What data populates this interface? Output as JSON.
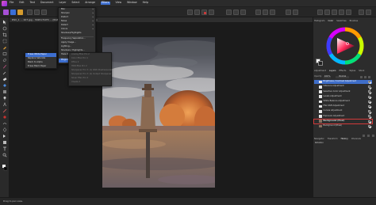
{
  "menubar": {
    "items": [
      "File",
      "Edit",
      "Text",
      "Document",
      "Layer",
      "Select",
      "Arrange",
      "Filters",
      "View",
      "Window",
      "Help"
    ]
  },
  "document": {
    "tab_label": "DSC_1 ... 207.jpg - 3420×5470 ... (RGBA/8) - sRGB IEC61966-2.1 (JPEG)",
    "close": "×"
  },
  "filters_menu": {
    "items": [
      {
        "label": "Blur",
        "submenu": true
      },
      {
        "label": "Sharpen",
        "submenu": true
      },
      {
        "label": "Distort",
        "submenu": true
      },
      {
        "label": "Noise",
        "submenu": true
      },
      {
        "label": "Detect",
        "submenu": true
      },
      {
        "label": "Colors",
        "submenu": true,
        "highlighted": true
      },
      {
        "label": "Shadows/Highlights"
      },
      {
        "separator": true
      },
      {
        "label": "Frequency Separation..."
      },
      {
        "label": "Apply Image..."
      },
      {
        "label": "Lighting..."
      },
      {
        "label": "Shadows / Highlights..."
      },
      {
        "label": "Haze Removal..."
      },
      {
        "separator": true
      },
      {
        "label": "Plugins",
        "submenu": true
      }
    ]
  },
  "colors_submenu": {
    "items": [
      {
        "label": "Erase White Paper",
        "highlighted": true
      },
      {
        "label": "Replace Saturate"
      },
      {
        "label": "Black to Alpha"
      },
      {
        "label": "Erase Black Paper"
      }
    ]
  },
  "plugin_submenu": {
    "items": [
      {
        "label": "Analog Efex Pro 2"
      },
      {
        "label": "Color Efex Pro 4"
      },
      {
        "label": "Dfine 2"
      },
      {
        "label": "HDR Efex Pro 2"
      },
      {
        "label": "Sharpener Pro 3: (1) RAW Presharpener"
      },
      {
        "label": "Sharpener Pro 3: (2) Output Sharpener"
      },
      {
        "label": "Silver Efex Pro 2"
      },
      {
        "label": "Viveza 2"
      }
    ]
  },
  "right_panel": {
    "color_tabs": [
      "Histogram",
      "Color",
      "Swatches",
      "Brushes"
    ],
    "layers_tabs": [
      "Adjustment",
      "Layers",
      "Effects",
      "Styles",
      "Stock"
    ],
    "opacity_label": "Opacity:",
    "opacity_value": "100 %",
    "blend_mode": "Normal",
    "layers": [
      {
        "name": "Brightness / Contrast Adjustment",
        "selected": true,
        "checked": true
      },
      {
        "name": "Vibrance Adjustment",
        "checked": true
      },
      {
        "name": "Selective Color Adjustment",
        "checked": true
      },
      {
        "name": "Levels Adjustment",
        "checked": true
      },
      {
        "name": "White Balance Adjustment",
        "checked": true
      },
      {
        "name": "HSL Shift Adjustment",
        "checked": true
      },
      {
        "name": "Curves Adjustment",
        "checked": true
      },
      {
        "name": "Exposure Adjustment",
        "checked": true
      },
      {
        "name": "Background (Pixel)",
        "checked": true,
        "highlighted_box": true
      },
      {
        "name": "Background (Pixel)",
        "checked": true
      }
    ],
    "bottom_tabs": [
      "Navigator",
      "Transform",
      "History",
      "Channels"
    ],
    "bottom_label": "Rotation"
  },
  "status": {
    "text": "Drag to pan view."
  },
  "colors": {
    "accent": "#3d6fd1",
    "highlight_box": "#d23a3a",
    "sky": "#7e8088",
    "foliage": "#d3834a"
  }
}
